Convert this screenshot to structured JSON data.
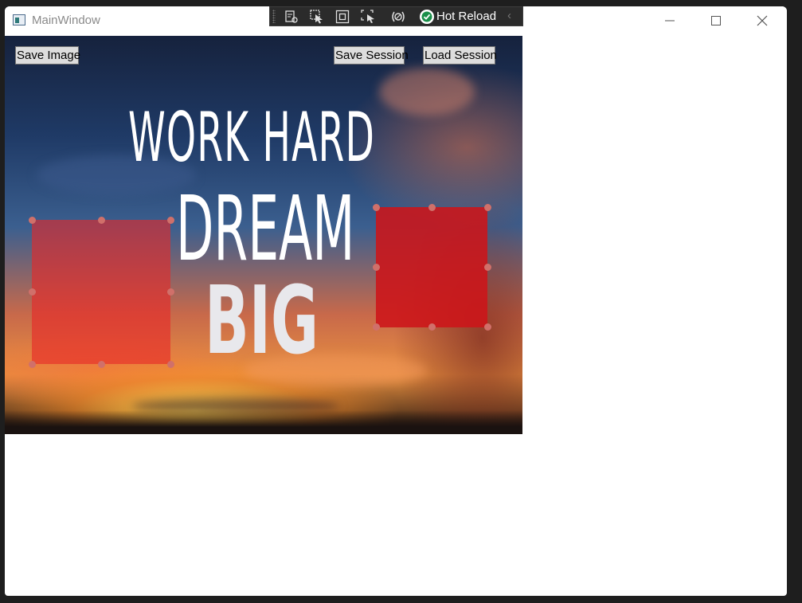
{
  "window": {
    "title": "MainWindow"
  },
  "hot_reload_toolbar": {
    "label": "Hot Reload",
    "tools": [
      "live-visual-tree-icon",
      "select-element-icon",
      "display-layout-adorners-icon",
      "track-focus-icon",
      "binding-failures-icon"
    ],
    "status": "success"
  },
  "toolbar": {
    "save_image_label": "Save Image",
    "save_session_label": "Save Session",
    "load_session_label": "Load Session"
  },
  "canvas": {
    "quote_line1": "WORK HARD",
    "quote_line2": "DREAM",
    "quote_line3": "BIG"
  },
  "colors": {
    "accent_rect_left": "#e62828",
    "accent_rect_right": "#cd1419",
    "handle": "#d0706a"
  }
}
